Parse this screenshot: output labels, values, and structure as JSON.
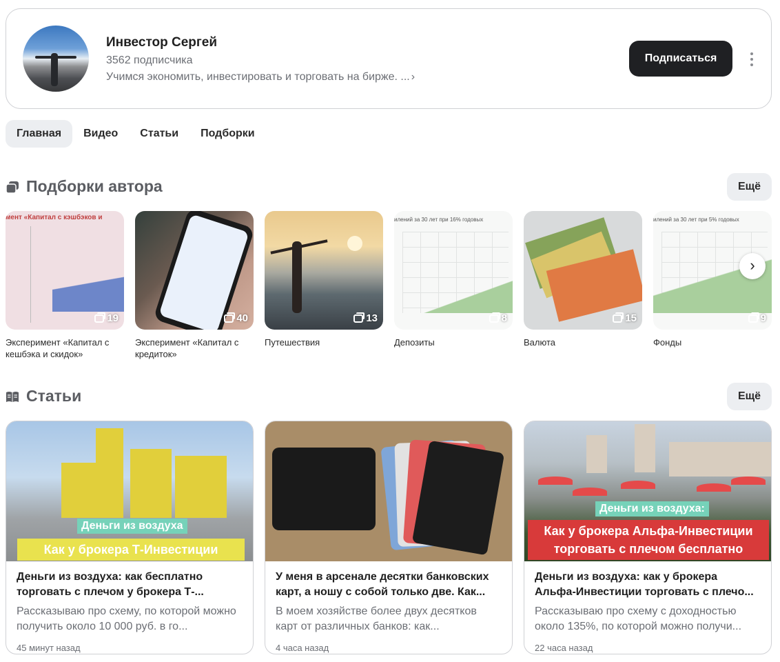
{
  "profile": {
    "name": "Инвестор Сергей",
    "subscribers": "3562 подписчика",
    "description": "Учимся экономить, инвестировать и торговать на бирже. ...",
    "subscribe_label": "Подписаться"
  },
  "tabs": [
    {
      "label": "Главная",
      "active": true
    },
    {
      "label": "Видео",
      "active": false
    },
    {
      "label": "Статьи",
      "active": false
    },
    {
      "label": "Подборки",
      "active": false
    }
  ],
  "collections_section": {
    "title": "Подборки автора",
    "more_label": "Ещё",
    "items": [
      {
        "label": "Эксперимент «Капитал с кешбэка и скидок»",
        "count": "19",
        "thumb_text": "мент «Капитал с кэшбэков и"
      },
      {
        "label": "Эксперимент «Капитал с кредиток»",
        "count": "40"
      },
      {
        "label": "Путешествия",
        "count": "13"
      },
      {
        "label": "Депозиты",
        "count": "8",
        "thumb_text": "илений за 30 лет при 16% годовых"
      },
      {
        "label": "Валюта",
        "count": "15"
      },
      {
        "label": "Фонды",
        "count": "9",
        "thumb_text": "илений за 30 лет при 5% годовых"
      }
    ]
  },
  "articles_section": {
    "title": "Статьи",
    "more_label": "Ещё",
    "items": [
      {
        "title": "Деньги из воздуха: как бесплатно торговать с плечом у брокера Т-...",
        "desc": "Рассказываю про схему, по которой можно получить около 10 000 руб. в го...",
        "time": "45 минут назад",
        "banner_top": "Деньги из воздуха",
        "banner_bottom": "Как у брокера Т-Инвестиции"
      },
      {
        "title": "У меня в арсенале десятки банковских карт, а ношу с собой только две. Как...",
        "desc": "В моем хозяйстве более двух десятков карт от различных банков: как...",
        "time": "4 часа назад"
      },
      {
        "title": "Деньги из воздуха: как у брокера Альфа-Инвестиции торговать с плечо...",
        "desc": "Рассказываю про схему с доходностью около 135%, по которой можно получи...",
        "time": "22 часа назад",
        "banner_top": "Деньги из воздуха:",
        "banner_bottom": "Как у брокера Альфа-Инвестиции торговать с плечом бесплатно"
      }
    ]
  },
  "colors": {
    "accent_dark": "#1f2023",
    "muted": "#6b6e74",
    "tab_active_bg": "#eceef1"
  }
}
